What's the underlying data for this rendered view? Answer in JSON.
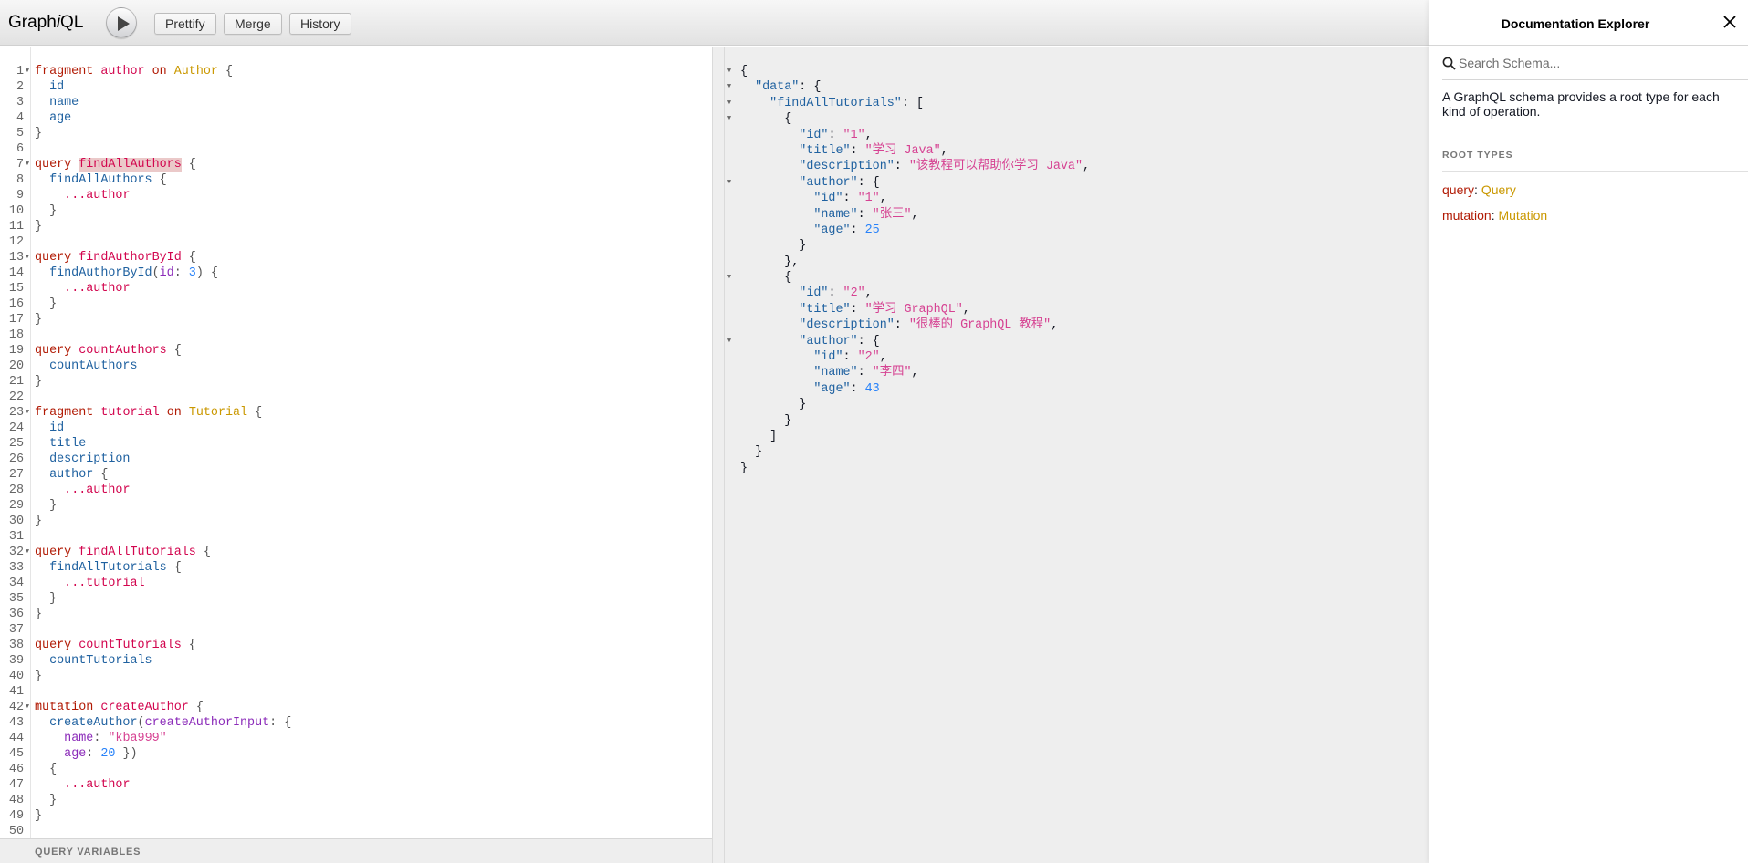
{
  "toolbar": {
    "logo_pre": "Graph",
    "logo_i": "i",
    "logo_post": "QL",
    "buttons": [
      "Prettify",
      "Merge",
      "History"
    ]
  },
  "editor": {
    "lines": [
      {
        "n": "1",
        "fold": true,
        "tokens": [
          [
            "kw",
            "fragment"
          ],
          [
            "",
            "​ "
          ],
          [
            "def",
            "author"
          ],
          [
            "",
            " "
          ],
          [
            "kw",
            "on"
          ],
          [
            "",
            " "
          ],
          [
            "ty",
            "Author"
          ],
          [
            "pun",
            " {"
          ]
        ]
      },
      {
        "n": "2",
        "tokens": [
          [
            "",
            "  "
          ],
          [
            "prop",
            "id"
          ]
        ]
      },
      {
        "n": "3",
        "tokens": [
          [
            "",
            "  "
          ],
          [
            "prop",
            "name"
          ]
        ]
      },
      {
        "n": "4",
        "tokens": [
          [
            "",
            "  "
          ],
          [
            "prop",
            "age"
          ]
        ]
      },
      {
        "n": "5",
        "tokens": [
          [
            "pun",
            "}"
          ]
        ]
      },
      {
        "n": "6",
        "tokens": []
      },
      {
        "n": "7",
        "fold": true,
        "tokens": [
          [
            "kw",
            "query"
          ],
          [
            "",
            " "
          ],
          [
            "def hl",
            "findAllAuthors"
          ],
          [
            "pun",
            " {"
          ]
        ]
      },
      {
        "n": "8",
        "tokens": [
          [
            "",
            "  "
          ],
          [
            "prop",
            "findAllAuthors"
          ],
          [
            "pun",
            " {"
          ]
        ]
      },
      {
        "n": "9",
        "tokens": [
          [
            "",
            "    "
          ],
          [
            "def",
            "...author"
          ]
        ]
      },
      {
        "n": "10",
        "tokens": [
          [
            "",
            "  "
          ],
          [
            "pun",
            "}"
          ]
        ]
      },
      {
        "n": "11",
        "tokens": [
          [
            "pun",
            "}"
          ]
        ]
      },
      {
        "n": "12",
        "tokens": []
      },
      {
        "n": "13",
        "fold": true,
        "tokens": [
          [
            "kw",
            "query"
          ],
          [
            "",
            " "
          ],
          [
            "def",
            "findAuthorById"
          ],
          [
            "pun",
            " {"
          ]
        ]
      },
      {
        "n": "14",
        "tokens": [
          [
            "",
            "  "
          ],
          [
            "prop",
            "findAuthorById"
          ],
          [
            "pun",
            "("
          ],
          [
            "attr",
            "id"
          ],
          [
            "pun",
            ": "
          ],
          [
            "num",
            "3"
          ],
          [
            "pun",
            ") {"
          ]
        ]
      },
      {
        "n": "15",
        "tokens": [
          [
            "",
            "    "
          ],
          [
            "def",
            "...author"
          ]
        ]
      },
      {
        "n": "16",
        "tokens": [
          [
            "",
            "  "
          ],
          [
            "pun",
            "}"
          ]
        ]
      },
      {
        "n": "17",
        "tokens": [
          [
            "pun",
            "}"
          ]
        ]
      },
      {
        "n": "18",
        "tokens": []
      },
      {
        "n": "19",
        "tokens": [
          [
            "kw",
            "query"
          ],
          [
            "",
            " "
          ],
          [
            "def",
            "countAuthors"
          ],
          [
            "pun",
            " {"
          ]
        ]
      },
      {
        "n": "20",
        "tokens": [
          [
            "",
            "  "
          ],
          [
            "prop",
            "countAuthors"
          ]
        ]
      },
      {
        "n": "21",
        "tokens": [
          [
            "pun",
            "}"
          ]
        ]
      },
      {
        "n": "22",
        "tokens": []
      },
      {
        "n": "23",
        "fold": true,
        "tokens": [
          [
            "kw",
            "fragment"
          ],
          [
            "",
            " "
          ],
          [
            "def",
            "tutorial"
          ],
          [
            "",
            " "
          ],
          [
            "kw",
            "on"
          ],
          [
            "",
            " "
          ],
          [
            "ty",
            "Tutorial"
          ],
          [
            "pun",
            " {"
          ]
        ]
      },
      {
        "n": "24",
        "tokens": [
          [
            "",
            "  "
          ],
          [
            "prop",
            "id"
          ]
        ]
      },
      {
        "n": "25",
        "tokens": [
          [
            "",
            "  "
          ],
          [
            "prop",
            "title"
          ]
        ]
      },
      {
        "n": "26",
        "tokens": [
          [
            "",
            "  "
          ],
          [
            "prop",
            "description"
          ]
        ]
      },
      {
        "n": "27",
        "tokens": [
          [
            "",
            "  "
          ],
          [
            "prop",
            "author"
          ],
          [
            "pun",
            " {"
          ]
        ]
      },
      {
        "n": "28",
        "tokens": [
          [
            "",
            "    "
          ],
          [
            "def",
            "...author"
          ]
        ]
      },
      {
        "n": "29",
        "tokens": [
          [
            "",
            "  "
          ],
          [
            "pun",
            "}"
          ]
        ]
      },
      {
        "n": "30",
        "tokens": [
          [
            "pun",
            "}"
          ]
        ]
      },
      {
        "n": "31",
        "tokens": []
      },
      {
        "n": "32",
        "fold": true,
        "tokens": [
          [
            "kw",
            "query"
          ],
          [
            "",
            " "
          ],
          [
            "def",
            "findAllTutorials"
          ],
          [
            "pun",
            " {"
          ]
        ]
      },
      {
        "n": "33",
        "tokens": [
          [
            "",
            "  "
          ],
          [
            "prop",
            "findAllTutorials"
          ],
          [
            "pun",
            " {"
          ]
        ]
      },
      {
        "n": "34",
        "tokens": [
          [
            "",
            "    "
          ],
          [
            "def",
            "...tutorial"
          ]
        ]
      },
      {
        "n": "35",
        "tokens": [
          [
            "",
            "  "
          ],
          [
            "pun",
            "}"
          ]
        ]
      },
      {
        "n": "36",
        "tokens": [
          [
            "pun",
            "}"
          ]
        ]
      },
      {
        "n": "37",
        "tokens": []
      },
      {
        "n": "38",
        "tokens": [
          [
            "kw",
            "query"
          ],
          [
            "",
            " "
          ],
          [
            "def",
            "countTutorials"
          ],
          [
            "pun",
            " {"
          ]
        ]
      },
      {
        "n": "39",
        "tokens": [
          [
            "",
            "  "
          ],
          [
            "prop",
            "countTutorials"
          ]
        ]
      },
      {
        "n": "40",
        "tokens": [
          [
            "pun",
            "}"
          ]
        ]
      },
      {
        "n": "41",
        "tokens": []
      },
      {
        "n": "42",
        "fold": true,
        "tokens": [
          [
            "kw",
            "mutation"
          ],
          [
            "",
            " "
          ],
          [
            "def",
            "createAuthor"
          ],
          [
            "pun",
            " {"
          ]
        ]
      },
      {
        "n": "43",
        "tokens": [
          [
            "",
            "  "
          ],
          [
            "prop",
            "createAuthor"
          ],
          [
            "pun",
            "("
          ],
          [
            "attr",
            "createAuthorInput"
          ],
          [
            "pun",
            ": {"
          ]
        ]
      },
      {
        "n": "44",
        "tokens": [
          [
            "",
            "    "
          ],
          [
            "attr",
            "name"
          ],
          [
            "pun",
            ": "
          ],
          [
            "str",
            "\"kba999\""
          ]
        ]
      },
      {
        "n": "45",
        "tokens": [
          [
            "",
            "    "
          ],
          [
            "attr",
            "age"
          ],
          [
            "pun",
            ": "
          ],
          [
            "num",
            "20"
          ],
          [
            "pun",
            " })"
          ]
        ]
      },
      {
        "n": "46",
        "tokens": [
          [
            "",
            "  "
          ],
          [
            "pun",
            "{"
          ]
        ]
      },
      {
        "n": "47",
        "tokens": [
          [
            "",
            "    "
          ],
          [
            "def",
            "...author"
          ]
        ]
      },
      {
        "n": "48",
        "tokens": [
          [
            "",
            "  "
          ],
          [
            "pun",
            "}"
          ]
        ]
      },
      {
        "n": "49",
        "tokens": [
          [
            "pun",
            "}"
          ]
        ]
      },
      {
        "n": "50",
        "tokens": []
      }
    ],
    "query_variables_label": "QUERY VARIABLES"
  },
  "result": {
    "lines": [
      {
        "fold": true,
        "tokens": [
          [
            "",
            "{"
          ]
        ]
      },
      {
        "fold": true,
        "tokens": [
          [
            "",
            "  "
          ],
          [
            "key",
            "\"data\""
          ],
          [
            "",
            ": {"
          ]
        ]
      },
      {
        "fold": true,
        "tokens": [
          [
            "",
            "    "
          ],
          [
            "key",
            "\"findAllTutorials\""
          ],
          [
            "",
            ": ["
          ]
        ]
      },
      {
        "fold": true,
        "tokens": [
          [
            "",
            "      {"
          ]
        ]
      },
      {
        "tokens": [
          [
            "",
            "        "
          ],
          [
            "key",
            "\"id\""
          ],
          [
            "",
            ": "
          ],
          [
            "sval",
            "\"1\""
          ],
          [
            "",
            ","
          ]
        ]
      },
      {
        "tokens": [
          [
            "",
            "        "
          ],
          [
            "key",
            "\"title\""
          ],
          [
            "",
            ": "
          ],
          [
            "sval",
            "\"学习 Java\""
          ],
          [
            "",
            ","
          ]
        ]
      },
      {
        "tokens": [
          [
            "",
            "        "
          ],
          [
            "key",
            "\"description\""
          ],
          [
            "",
            ": "
          ],
          [
            "sval",
            "\"该教程可以帮助你学习 Java\""
          ],
          [
            "",
            ","
          ]
        ]
      },
      {
        "fold": true,
        "tokens": [
          [
            "",
            "        "
          ],
          [
            "key",
            "\"author\""
          ],
          [
            "",
            ": {"
          ]
        ]
      },
      {
        "tokens": [
          [
            "",
            "          "
          ],
          [
            "key",
            "\"id\""
          ],
          [
            "",
            ": "
          ],
          [
            "sval",
            "\"1\""
          ],
          [
            "",
            ","
          ]
        ]
      },
      {
        "tokens": [
          [
            "",
            "          "
          ],
          [
            "key",
            "\"name\""
          ],
          [
            "",
            ": "
          ],
          [
            "sval",
            "\"张三\""
          ],
          [
            "",
            ","
          ]
        ]
      },
      {
        "tokens": [
          [
            "",
            "          "
          ],
          [
            "key",
            "\"age\""
          ],
          [
            "",
            ": "
          ],
          [
            "nval",
            "25"
          ]
        ]
      },
      {
        "tokens": [
          [
            "",
            "        }"
          ]
        ]
      },
      {
        "tokens": [
          [
            "",
            "      },"
          ]
        ]
      },
      {
        "fold": true,
        "tokens": [
          [
            "",
            "      {"
          ]
        ]
      },
      {
        "tokens": [
          [
            "",
            "        "
          ],
          [
            "key",
            "\"id\""
          ],
          [
            "",
            ": "
          ],
          [
            "sval",
            "\"2\""
          ],
          [
            "",
            ","
          ]
        ]
      },
      {
        "tokens": [
          [
            "",
            "        "
          ],
          [
            "key",
            "\"title\""
          ],
          [
            "",
            ": "
          ],
          [
            "sval",
            "\"学习 GraphQL\""
          ],
          [
            "",
            ","
          ]
        ]
      },
      {
        "tokens": [
          [
            "",
            "        "
          ],
          [
            "key",
            "\"description\""
          ],
          [
            "",
            ": "
          ],
          [
            "sval",
            "\"很棒的 GraphQL 教程\""
          ],
          [
            "",
            ","
          ]
        ]
      },
      {
        "fold": true,
        "tokens": [
          [
            "",
            "        "
          ],
          [
            "key",
            "\"author\""
          ],
          [
            "",
            ": {"
          ]
        ]
      },
      {
        "tokens": [
          [
            "",
            "          "
          ],
          [
            "key",
            "\"id\""
          ],
          [
            "",
            ": "
          ],
          [
            "sval",
            "\"2\""
          ],
          [
            "",
            ","
          ]
        ]
      },
      {
        "tokens": [
          [
            "",
            "          "
          ],
          [
            "key",
            "\"name\""
          ],
          [
            "",
            ": "
          ],
          [
            "sval",
            "\"李四\""
          ],
          [
            "",
            ","
          ]
        ]
      },
      {
        "tokens": [
          [
            "",
            "          "
          ],
          [
            "key",
            "\"age\""
          ],
          [
            "",
            ": "
          ],
          [
            "nval",
            "43"
          ]
        ]
      },
      {
        "tokens": [
          [
            "",
            "        }"
          ]
        ]
      },
      {
        "tokens": [
          [
            "",
            "      }"
          ]
        ]
      },
      {
        "tokens": [
          [
            "",
            "    ]"
          ]
        ]
      },
      {
        "tokens": [
          [
            "",
            "  }"
          ]
        ]
      },
      {
        "tokens": [
          [
            "",
            "}"
          ]
        ]
      }
    ]
  },
  "docs": {
    "title": "Documentation Explorer",
    "search_placeholder": "Search Schema...",
    "description": "A GraphQL schema provides a root type for each kind of operation.",
    "root_types_header": "ROOT TYPES",
    "root_types": [
      {
        "field": "query",
        "type": "Query"
      },
      {
        "field": "mutation",
        "type": "Mutation"
      }
    ]
  },
  "colors": {
    "keyword": "#b11a04",
    "definition": "#d2054e",
    "type": "#ca9800",
    "property": "#1f61a0",
    "attribute": "#8b2bb9",
    "number": "#2882f9",
    "string": "#d64292"
  },
  "icons": [
    "play-icon",
    "search-icon",
    "close-icon",
    "fold-arrow-icon"
  ]
}
